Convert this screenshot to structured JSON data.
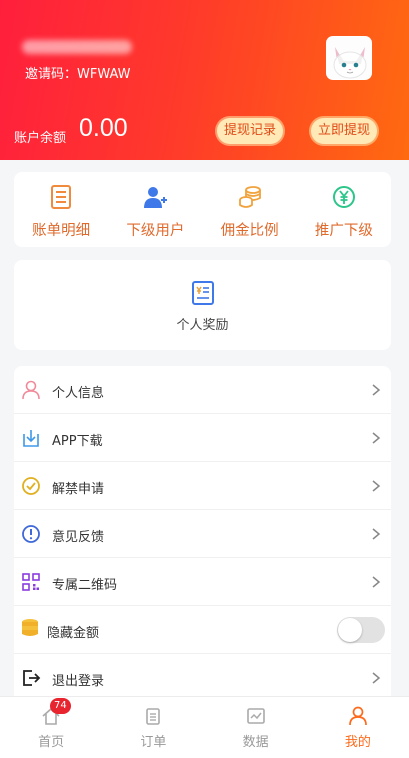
{
  "header": {
    "invite_text": "邀请码：WFWAW",
    "balance_label": "账户余额",
    "balance_value": "0.00",
    "withdraw_record_label": "提现记录",
    "withdraw_now_label": "立即提现"
  },
  "grid": [
    {
      "label": "账单明细",
      "icon": "bill-icon"
    },
    {
      "label": "下级用户",
      "icon": "add-user-icon"
    },
    {
      "label": "佣金比例",
      "icon": "coins-icon"
    },
    {
      "label": "推广下级",
      "icon": "yuan-icon"
    }
  ],
  "reward": {
    "label": "个人奖励",
    "icon": "reward-icon"
  },
  "menu": [
    {
      "label": "个人信息",
      "icon": "person-icon"
    },
    {
      "label": "APP下载",
      "icon": "download-icon"
    },
    {
      "label": "解禁申请",
      "icon": "check-circle-icon"
    },
    {
      "label": "意见反馈",
      "icon": "info-icon"
    },
    {
      "label": "专属二维码",
      "icon": "qrcode-icon"
    },
    {
      "label": "隐藏金额",
      "icon": "coin-stack-icon",
      "toggle": false
    },
    {
      "label": "退出登录",
      "icon": "logout-icon"
    }
  ],
  "tabbar": {
    "home_label": "首页",
    "home_badge": "74",
    "orders_label": "订单",
    "data_label": "数据",
    "mine_label": "我的",
    "active": "我的"
  },
  "colors": {
    "accent": "#ff6a1a",
    "header_start": "#ff1f3d",
    "header_end": "#ff6a10",
    "grid_label": "#e06a2c"
  }
}
